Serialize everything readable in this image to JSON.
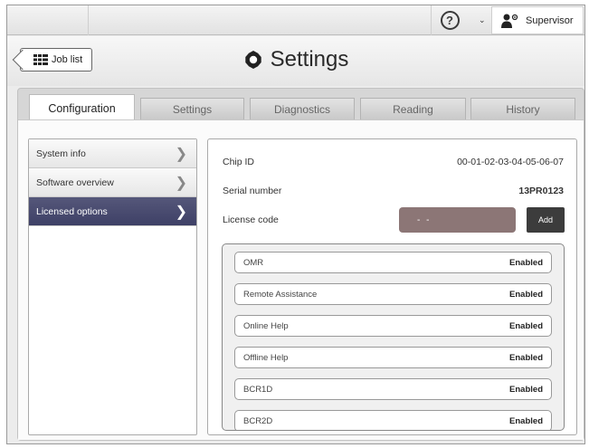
{
  "topbar": {
    "help_icon_glyph": "?",
    "user_label": "Supervisor"
  },
  "header": {
    "job_list_label": "Job list",
    "title": "Settings"
  },
  "tabs": [
    {
      "label": "Configuration",
      "active": true
    },
    {
      "label": "Settings",
      "active": false
    },
    {
      "label": "Diagnostics",
      "active": false
    },
    {
      "label": "Reading",
      "active": false
    },
    {
      "label": "History",
      "active": false
    }
  ],
  "menu": [
    {
      "label": "System info",
      "active": false
    },
    {
      "label": "Software overview",
      "active": false
    },
    {
      "label": "Licensed options",
      "active": true
    }
  ],
  "info": {
    "chip_id_label": "Chip ID",
    "chip_id_value": "00-01-02-03-04-05-06-07",
    "serial_label": "Serial number",
    "serial_value": "13PR0123",
    "license_label": "License code",
    "license_value": "- -",
    "add_label": "Add"
  },
  "options": [
    {
      "name": "OMR",
      "status": "Enabled"
    },
    {
      "name": "Remote Assistance",
      "status": "Enabled"
    },
    {
      "name": "Online Help",
      "status": "Enabled"
    },
    {
      "name": "Offline Help",
      "status": "Enabled"
    },
    {
      "name": "BCR1D",
      "status": "Enabled"
    },
    {
      "name": "BCR2D",
      "status": "Enabled"
    }
  ],
  "colors": {
    "active_menu": "#4a4c70",
    "license_field": "#8c7676",
    "add_button": "#3c3c3c"
  }
}
